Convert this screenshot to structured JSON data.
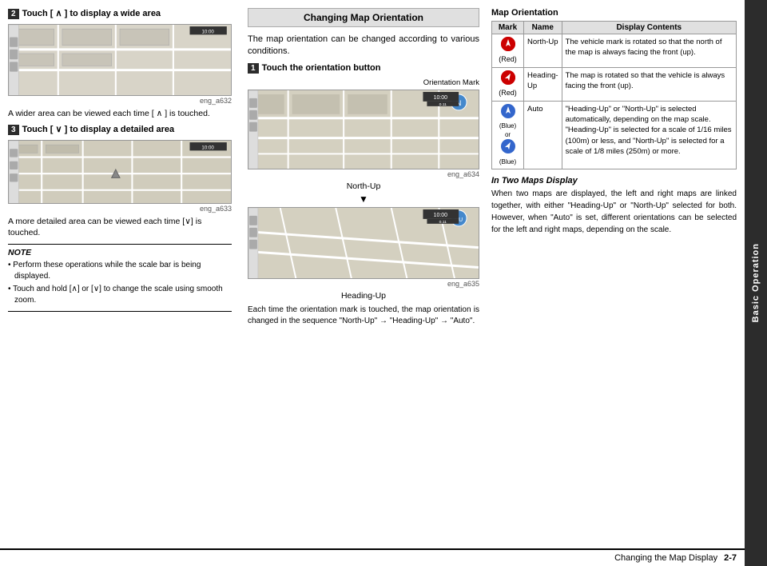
{
  "sidebar": {
    "label": "Basic Operation"
  },
  "left_column": {
    "step2_label": "2",
    "step2_heading": "Touch [ ∧ ] to display a wide area",
    "img1_caption": "eng_a632",
    "step2_body": "A wider area can be viewed each time [ ∧ ] is touched.",
    "step3_label": "3",
    "step3_heading": "Touch [ ∨ ] to display a detailed area",
    "img2_caption": "eng_a633",
    "step3_body": "A more detailed area can be viewed each time [∨] is touched.",
    "note_title": "NOTE",
    "note_items": [
      "Perform these operations while the scale bar is being displayed.",
      "Touch and hold [∧] or [∨] to change the scale using smooth zoom."
    ]
  },
  "middle_column": {
    "section_header": "Changing Map Orientation",
    "intro_text": "The map orientation can be changed according to various conditions.",
    "step1_label": "1",
    "step1_heading": "Touch the orientation button",
    "orientation_mark_label": "Orientation Mark",
    "img3_caption": "eng_a634",
    "north_up_label": "North-Up",
    "img4_caption": "eng_a635",
    "heading_up_label": "Heading-Up",
    "body_text": "Each time the orientation mark is touched, the map orientation is changed in the sequence \"North-Up\" → \"Heading-Up\" → \"Auto\"."
  },
  "right_column": {
    "table_title": "Map Orientation",
    "col_headers": [
      "Mark",
      "Name",
      "Display Contents"
    ],
    "rows": [
      {
        "icon_color": "red",
        "icon_label": "(Red)",
        "name": "North-Up",
        "description": "The vehicle mark is rotated so that the north of the map is always facing the front (up)."
      },
      {
        "icon_color": "red",
        "icon_label": "(Red)",
        "name": "Heading-\nUp",
        "description": "The map is rotated so that the vehicle is always facing the front (up)."
      },
      {
        "icon_color1": "blue",
        "icon_color2": "blue",
        "icon_label": "(Blue)\nor\n(Blue)",
        "name": "Auto",
        "description": "\"Heading-Up\" or \"North-Up\" is selected automatically, depending on the map scale. \"Heading-Up\" is selected for a scale of 1/16 miles (100m) or less, and \"North-Up\" is selected for a scale of 1/8 miles (250m) or more."
      }
    ],
    "in_two_maps_title": "In Two Maps Display",
    "in_two_maps_body": "When two maps are displayed, the left and right maps are linked together, with either \"Heading-Up\" or \"North-Up\" selected for both. However, when \"Auto\" is set, different orientations can be selected for the left and right maps, depending on the scale."
  },
  "bottom": {
    "label": "Changing the Map Display",
    "page": "2-7"
  }
}
